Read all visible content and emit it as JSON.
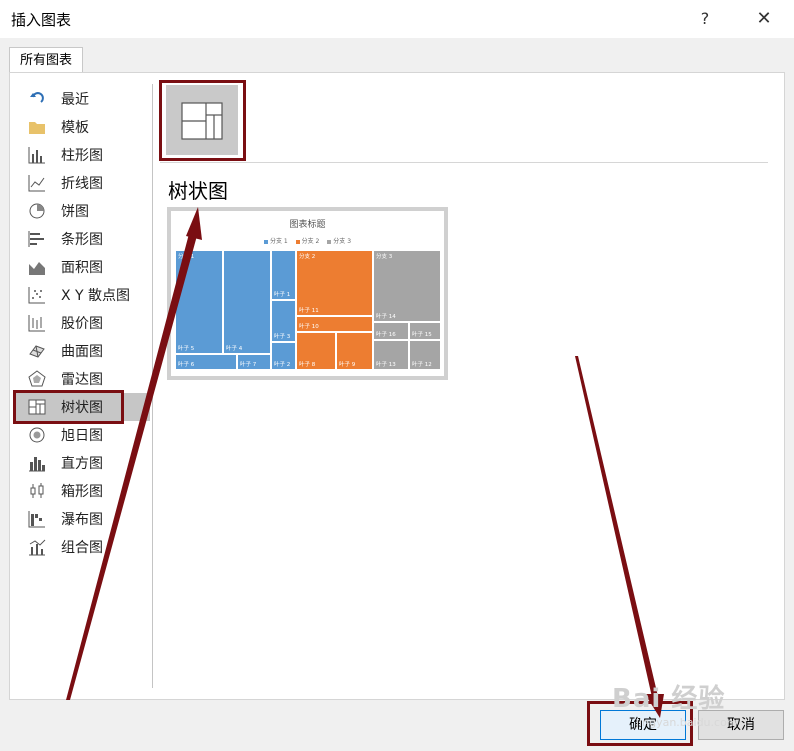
{
  "dialog": {
    "title": "插入图表",
    "help": "?",
    "close": "✕"
  },
  "tabs": [
    {
      "label": "所有图表"
    }
  ],
  "categories": [
    {
      "label": "最近",
      "icon": "recent-icon"
    },
    {
      "label": "模板",
      "icon": "folder-icon"
    },
    {
      "label": "柱形图",
      "icon": "column-chart-icon"
    },
    {
      "label": "折线图",
      "icon": "line-chart-icon"
    },
    {
      "label": "饼图",
      "icon": "pie-chart-icon"
    },
    {
      "label": "条形图",
      "icon": "bar-chart-icon"
    },
    {
      "label": "面积图",
      "icon": "area-chart-icon"
    },
    {
      "label": "X Y 散点图",
      "icon": "scatter-chart-icon"
    },
    {
      "label": "股价图",
      "icon": "stock-chart-icon"
    },
    {
      "label": "曲面图",
      "icon": "surface-chart-icon"
    },
    {
      "label": "雷达图",
      "icon": "radar-chart-icon"
    },
    {
      "label": "树状图",
      "icon": "treemap-icon",
      "selected": true
    },
    {
      "label": "旭日图",
      "icon": "sunburst-icon"
    },
    {
      "label": "直方图",
      "icon": "histogram-icon"
    },
    {
      "label": "箱形图",
      "icon": "box-whisker-icon"
    },
    {
      "label": "瀑布图",
      "icon": "waterfall-icon"
    },
    {
      "label": "组合图",
      "icon": "combo-chart-icon"
    }
  ],
  "selected_chart": {
    "name": "树状图",
    "preview": {
      "title": "图表标题",
      "legend": [
        "分支 1",
        "分支 2",
        "分支 3"
      ],
      "colors": {
        "branch1": "#5b9bd5",
        "branch2": "#ed7d31",
        "branch3": "#a5a5a5",
        "accent": "#7a0e12"
      },
      "branch_labels": [
        "分支 1",
        "分支 2",
        "分支 3"
      ],
      "leaf_labels": [
        "叶子 5",
        "叶子 4",
        "叶子 6",
        "叶子 7",
        "叶子 1",
        "叶子 3",
        "叶子 2",
        "叶子 11",
        "叶子 10",
        "叶子 8",
        "叶子 9",
        "叶子 14",
        "叶子 16",
        "叶子 15",
        "叶子 13",
        "叶子 12"
      ]
    }
  },
  "buttons": {
    "ok": "确定",
    "cancel": "取消"
  },
  "watermark": {
    "text": "Bai 经验",
    "url": "jingyan.baidu.com"
  }
}
